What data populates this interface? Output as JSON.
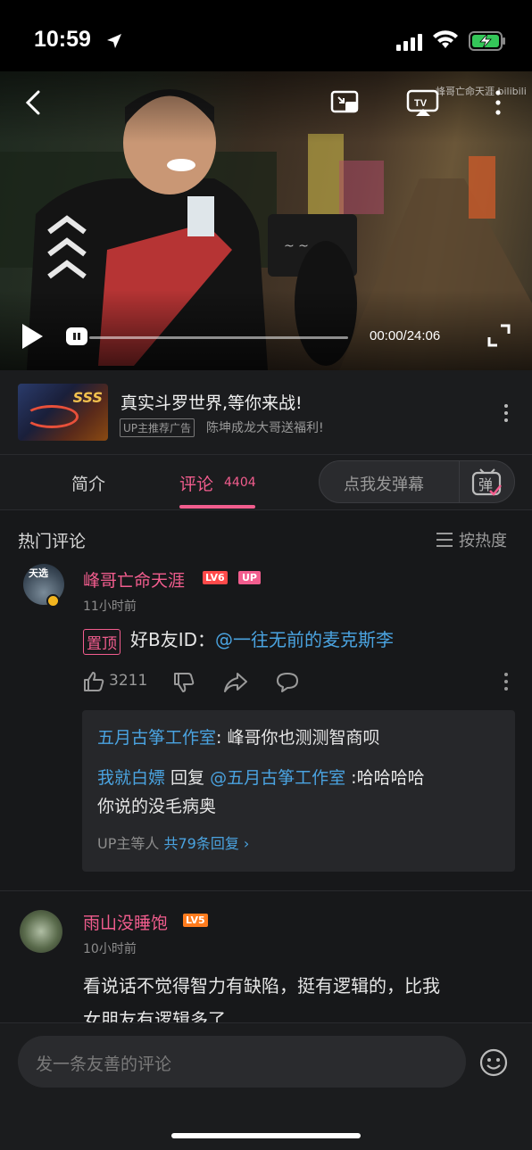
{
  "status_bar": {
    "time": "10:59"
  },
  "video": {
    "watermark": "峰哥亡命天涯  bilibili",
    "time": "00:00/24:06",
    "tv_label": "TV"
  },
  "ad": {
    "thumb_badge": "SSS",
    "title": "真实斗罗世界,等你来战!",
    "tag": "UP主推荐广告",
    "subtitle": "陈坤成龙大哥送福利!"
  },
  "tabs": {
    "intro": "简介",
    "comments": "评论",
    "comments_count": "4404",
    "danmu_placeholder": "点我发弹幕",
    "danmu_icon_label": "弹"
  },
  "comments_header": {
    "title": "热门评论",
    "sort": "按热度"
  },
  "comments": [
    {
      "avatar_text": "天选",
      "username": "峰哥亡命天涯",
      "level": "LV6",
      "up_tag": "UP",
      "time": "11小时前",
      "pinned": "置顶",
      "text": "好B友ID：",
      "mention": "@一往无前的麦克斯李",
      "likes": "3211",
      "replies": [
        {
          "name": "五月古筝工作室",
          "text": ": 峰哥你也测测智商呗"
        },
        {
          "name": "我就白嫖",
          "text": " 回复 ",
          "mention": "@五月古筝工作室",
          "text2": " :哈哈哈哈",
          "line2": "你说的没毛病奥"
        }
      ],
      "more_prefix": "UP主等人 ",
      "more_count": "共79条回复 ›"
    },
    {
      "username": "雨山没睡饱",
      "level": "LV5",
      "time": "10小时前",
      "line1": "看说话不觉得智力有缺陷，挺有逻辑的，比我",
      "line2": "女朋友有逻辑多了"
    }
  ],
  "bottom": {
    "input_placeholder": "发一条友善的评论"
  },
  "colors": {
    "accent": "#f25d8e",
    "link": "#4aa3e0",
    "background": "#17181a"
  }
}
